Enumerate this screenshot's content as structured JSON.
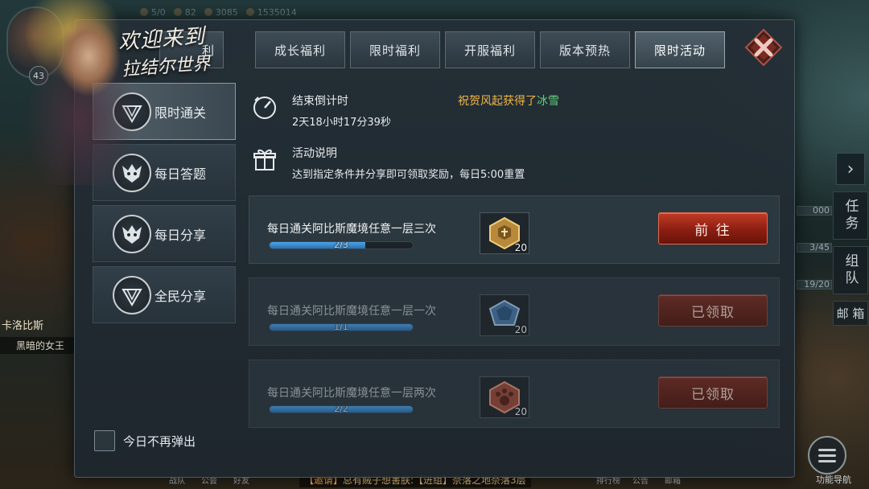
{
  "hud": {
    "topbar": [
      {
        "icon": "stamina-icon",
        "value": "5/0"
      },
      {
        "icon": "level-icon",
        "value": "82"
      },
      {
        "icon": "diamond-icon",
        "value": "3085"
      },
      {
        "icon": "gold-icon",
        "value": "1535014"
      }
    ],
    "player_level": "43",
    "left_name": "卡洛比斯",
    "left_title": "黑暗的女王",
    "right_tabs": [
      "任务",
      "组队"
    ],
    "right_bars": [
      "000",
      "3/45",
      "19/20"
    ],
    "mail_label": "邮 箱",
    "bottom_buttons": [
      "战队",
      "公会",
      "好友",
      "排行榜",
      "公告",
      "邮箱"
    ],
    "chat": {
      "tag": "【邀请】",
      "text": "总有贼子想害朕:【进组】奈落之地奈落3层"
    },
    "menu_label": "功能导航"
  },
  "welcome": {
    "line1": "欢迎来到",
    "line2": "拉结尔世界"
  },
  "tabs": [
    {
      "label": "利",
      "partial": true
    },
    {
      "label": "成长福利"
    },
    {
      "label": "限时福利"
    },
    {
      "label": "开服福利"
    },
    {
      "label": "版本预热"
    },
    {
      "label": "限时活动",
      "active": true
    }
  ],
  "sidebar": [
    {
      "label": "限时通关",
      "icon": "crystal-emblem-icon",
      "active": true
    },
    {
      "label": "每日答题",
      "icon": "demon-emblem-icon"
    },
    {
      "label": "每日分享",
      "icon": "demon-emblem-icon"
    },
    {
      "label": "全民分享",
      "icon": "crystal-emblem-icon"
    }
  ],
  "countdown": {
    "title": "结束倒计时",
    "value": "2天18小时17分39秒"
  },
  "description": {
    "title": "活动说明",
    "text": "达到指定条件并分享即可领取奖励，每日5:00重置"
  },
  "marquee": {
    "prefix": "祝贺风起获得了",
    "highlight": "冰雪"
  },
  "tasks": [
    {
      "name": "每日通关阿比斯魔境任意一层三次",
      "progress_text": "2/3",
      "progress": 0.667,
      "reward_count": "20",
      "reward_icon": "gold-badge-icon",
      "button": "前 往",
      "done": false
    },
    {
      "name": "每日通关阿比斯魔境任意一层一次",
      "progress_text": "1/1",
      "progress": 1.0,
      "reward_count": "20",
      "reward_icon": "blue-gem-icon",
      "button": "已领取",
      "done": true
    },
    {
      "name": "每日通关阿比斯魔境任意一层两次",
      "progress_text": "2/2",
      "progress": 1.0,
      "reward_count": "20",
      "reward_icon": "red-paw-badge-icon",
      "button": "已领取",
      "done": true
    }
  ],
  "checkbox_label": "今日不再弹出",
  "colors": {
    "accent_red": "#c23b24",
    "progress_blue": "#4aa4e8",
    "marquee_gold": "#f0b64a",
    "marquee_green": "#5fd07c"
  }
}
